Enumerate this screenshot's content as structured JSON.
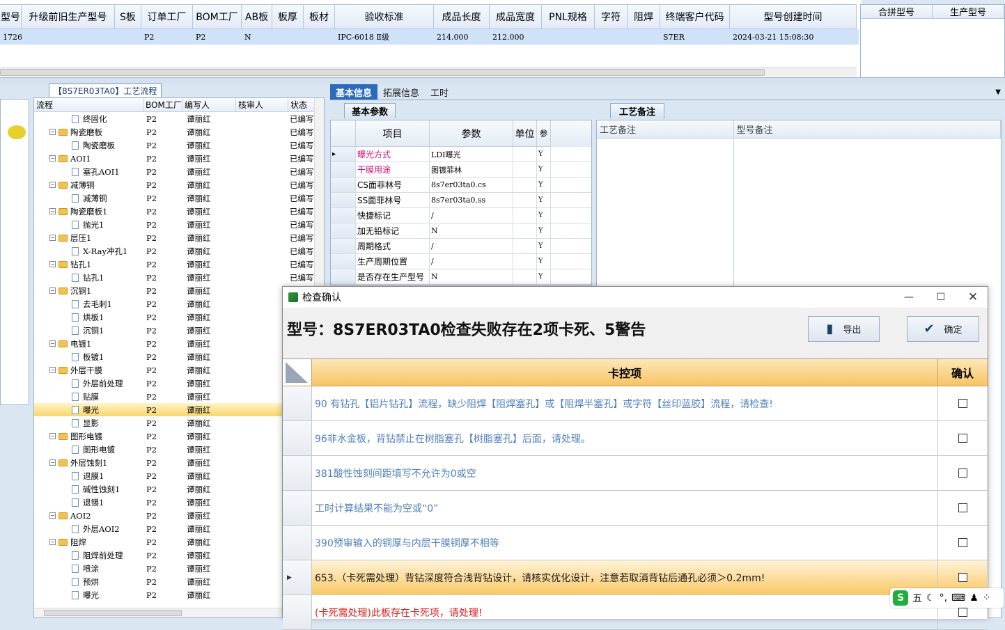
{
  "top_table": {
    "headers": [
      "型号",
      "升级前旧生产型号",
      "S板",
      "订单工厂",
      "BOM工厂",
      "AB板",
      "板厚",
      "板材",
      "验收标准",
      "成品长度",
      "成品宽度",
      "PNL规格",
      "字符",
      "阻焊",
      "终端客户代码",
      "型号创建时间"
    ],
    "row": [
      "1726",
      "",
      "",
      "P2",
      "P2",
      "N",
      "",
      "",
      "IPC-6018 Ⅱ级",
      "214.000",
      "212.000",
      "",
      "",
      "",
      "S7ER",
      "2024-03-21 15:08:30"
    ]
  },
  "side_table": {
    "headers": [
      "合拼型号",
      "生产型号"
    ]
  },
  "tree": {
    "caption": "【8S7ER03TA0】工艺流程",
    "headers": [
      "流程",
      "BOM工厂",
      "编写人",
      "核审人",
      "状态"
    ],
    "rows": [
      {
        "level": 2,
        "name": "终固化",
        "bom": "P2",
        "writer": "谭丽红",
        "status": "已编写"
      },
      {
        "level": 1,
        "name": "陶瓷磨板",
        "bom": "P2",
        "writer": "谭丽红",
        "status": "已编写"
      },
      {
        "level": 2,
        "name": "陶瓷磨板",
        "bom": "P2",
        "writer": "谭丽红",
        "status": "已编写"
      },
      {
        "level": 1,
        "name": "AOI1",
        "bom": "P2",
        "writer": "谭丽红",
        "status": "已编写"
      },
      {
        "level": 2,
        "name": "塞孔AOI1",
        "bom": "P2",
        "writer": "谭丽红",
        "status": "已编写"
      },
      {
        "level": 1,
        "name": "减薄铜",
        "bom": "P2",
        "writer": "谭丽红",
        "status": "已编写"
      },
      {
        "level": 2,
        "name": "减薄铜",
        "bom": "P2",
        "writer": "谭丽红",
        "status": "已编写"
      },
      {
        "level": 1,
        "name": "陶瓷磨板1",
        "bom": "P2",
        "writer": "谭丽红",
        "status": "已编写"
      },
      {
        "level": 2,
        "name": "抛光1",
        "bom": "P2",
        "writer": "谭丽红",
        "status": "已编写"
      },
      {
        "level": 1,
        "name": "层压1",
        "bom": "P2",
        "writer": "谭丽红",
        "status": "已编写"
      },
      {
        "level": 2,
        "name": "X-Ray冲孔1",
        "bom": "P2",
        "writer": "谭丽红",
        "status": "已编写"
      },
      {
        "level": 1,
        "name": "钻孔1",
        "bom": "P2",
        "writer": "谭丽红",
        "status": "已编写"
      },
      {
        "level": 2,
        "name": "钻孔1",
        "bom": "P2",
        "writer": "谭丽红",
        "status": "已编写"
      },
      {
        "level": 1,
        "name": "沉铜1",
        "bom": "P2",
        "writer": "谭丽红",
        "status": ""
      },
      {
        "level": 2,
        "name": "去毛刺1",
        "bom": "P2",
        "writer": "谭丽红",
        "status": ""
      },
      {
        "level": 2,
        "name": "烘板1",
        "bom": "P2",
        "writer": "谭丽红",
        "status": ""
      },
      {
        "level": 2,
        "name": "沉铜1",
        "bom": "P2",
        "writer": "谭丽红",
        "status": ""
      },
      {
        "level": 1,
        "name": "电镀1",
        "bom": "P2",
        "writer": "谭丽红",
        "status": ""
      },
      {
        "level": 2,
        "name": "板镀1",
        "bom": "P2",
        "writer": "谭丽红",
        "status": ""
      },
      {
        "level": 1,
        "name": "外层干膜",
        "bom": "P2",
        "writer": "谭丽红",
        "status": ""
      },
      {
        "level": 2,
        "name": "外层前处理",
        "bom": "P2",
        "writer": "谭丽红",
        "status": ""
      },
      {
        "level": 2,
        "name": "贴膜",
        "bom": "P2",
        "writer": "谭丽红",
        "status": ""
      },
      {
        "level": 2,
        "name": "曝光",
        "bom": "P2",
        "writer": "谭丽红",
        "status": "",
        "selected": true
      },
      {
        "level": 2,
        "name": "显影",
        "bom": "P2",
        "writer": "谭丽红",
        "status": ""
      },
      {
        "level": 1,
        "name": "图形电镀",
        "bom": "P2",
        "writer": "谭丽红",
        "status": ""
      },
      {
        "level": 2,
        "name": "图形电镀",
        "bom": "P2",
        "writer": "谭丽红",
        "status": ""
      },
      {
        "level": 1,
        "name": "外层蚀刻1",
        "bom": "P2",
        "writer": "谭丽红",
        "status": ""
      },
      {
        "level": 2,
        "name": "退膜1",
        "bom": "P2",
        "writer": "谭丽红",
        "status": ""
      },
      {
        "level": 2,
        "name": "碱性蚀刻1",
        "bom": "P2",
        "writer": "谭丽红",
        "status": ""
      },
      {
        "level": 2,
        "name": "退锡1",
        "bom": "P2",
        "writer": "谭丽红",
        "status": ""
      },
      {
        "level": 1,
        "name": "AOI2",
        "bom": "P2",
        "writer": "谭丽红",
        "status": ""
      },
      {
        "level": 2,
        "name": "外层AOI2",
        "bom": "P2",
        "writer": "谭丽红",
        "status": ""
      },
      {
        "level": 1,
        "name": "阻焊",
        "bom": "P2",
        "writer": "谭丽红",
        "status": ""
      },
      {
        "level": 2,
        "name": "阻焊前处理",
        "bom": "P2",
        "writer": "谭丽红",
        "status": ""
      },
      {
        "level": 2,
        "name": "喷涂",
        "bom": "P2",
        "writer": "谭丽红",
        "status": ""
      },
      {
        "level": 2,
        "name": "预烘",
        "bom": "P2",
        "writer": "谭丽红",
        "status": ""
      },
      {
        "level": 2,
        "name": "曝光",
        "bom": "P2",
        "writer": "谭丽红",
        "status": ""
      }
    ]
  },
  "tabs": [
    "基本信息",
    "拓展信息",
    "工时"
  ],
  "params": {
    "caption": "基本参数",
    "headers": [
      "项目",
      "参数",
      "单位",
      "参"
    ],
    "rows": [
      {
        "item": "曝光方式",
        "value": "LDI曝光",
        "unit": "",
        "flag": "Y",
        "pink": true
      },
      {
        "item": "干膜用途",
        "value": "图镀菲林",
        "unit": "",
        "flag": "Y",
        "pink": true
      },
      {
        "item": "CS面菲林号",
        "value": "8s7er03ta0.cs",
        "unit": "",
        "flag": "Y"
      },
      {
        "item": "SS面菲林号",
        "value": "8s7er03ta0.ss",
        "unit": "",
        "flag": "Y"
      },
      {
        "item": "快捷标记",
        "value": "/",
        "unit": "",
        "flag": "Y"
      },
      {
        "item": "加无铅标记",
        "value": "N",
        "unit": "",
        "flag": "Y"
      },
      {
        "item": "周期格式",
        "value": "/",
        "unit": "",
        "flag": "Y"
      },
      {
        "item": "生产周期位置",
        "value": "/",
        "unit": "",
        "flag": "Y"
      },
      {
        "item": "是否存在生产型号",
        "value": "N",
        "unit": "",
        "flag": "Y"
      }
    ]
  },
  "notes": {
    "caption": "工艺备注",
    "headers": [
      "工艺备注",
      "型号备注"
    ]
  },
  "dialog": {
    "title": "检查确认",
    "heading": "型号：8S7ER03TA0检查失败存在2项卡死、5警告",
    "export_label": "导出",
    "confirm_label": "确定",
    "col_item": "卡控项",
    "col_confirm": "确认",
    "rows": [
      {
        "text": "90 有钻孔【铝片钻孔】流程，缺少阻焊【阻焊塞孔】或【阻焊半塞孔】或字符【丝印蓝胶】流程，请检查!",
        "style": "warn"
      },
      {
        "text": "96非水金板，背钻禁止在树脂塞孔【树脂塞孔】后面，请处理。",
        "style": "warn"
      },
      {
        "text": "381酸性蚀刻间距填写不允许为0或空",
        "style": "warn"
      },
      {
        "text": "工时计算结果不能为空或“0”",
        "style": "warn"
      },
      {
        "text": "390预审输入的铜厚与内层干膜铜厚不相等",
        "style": "warn"
      },
      {
        "text": "653.（卡死需处理）背钻深度符合浅背钻设计，请核实优化设计，注意若取消背钻后通孔必须＞0.2mm!",
        "style": "hl"
      },
      {
        "text": "(卡死需处理)此板存在卡死项，请处理!",
        "style": "red"
      }
    ]
  },
  "ime": {
    "label": "五"
  }
}
